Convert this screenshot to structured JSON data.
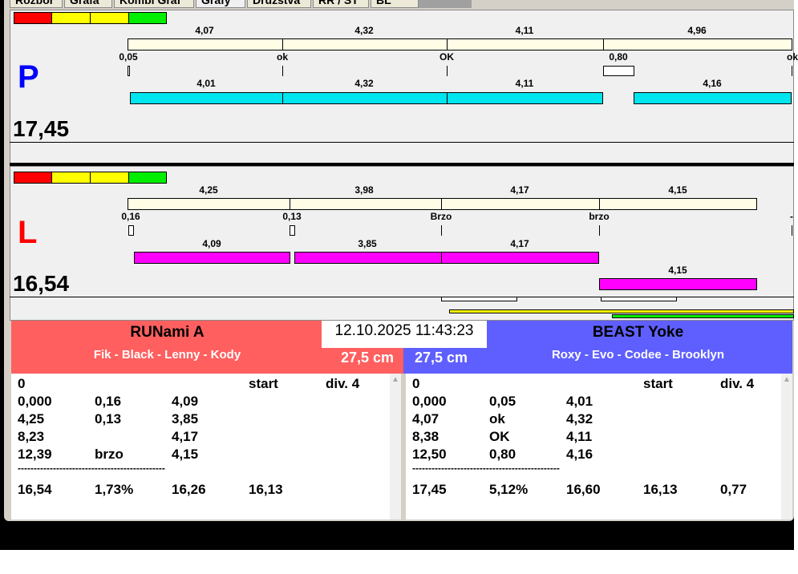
{
  "tabs": [
    "Rozbor",
    "Grafa",
    "Kombi Graf",
    "Grafy",
    "Družstva",
    "RR / ST",
    "BL"
  ],
  "colors": {
    "red_team": "#ff5f5f",
    "blue_team": "#5f5fff",
    "cyan": "#00e5ee",
    "magenta": "#ff00ff",
    "cream": "#fffde6"
  },
  "lane_p": {
    "letter": "P",
    "total": "17,45",
    "split_labels": [
      "4,07",
      "4,32",
      "4,11",
      "4,96"
    ],
    "reaction_labels": [
      "0,05",
      "ok",
      "OK",
      "0,80",
      "ok"
    ],
    "run_labels": [
      "4,01",
      "4,32",
      "4,11",
      "4,16"
    ]
  },
  "lane_l": {
    "letter": "L",
    "total": "16,54",
    "split_labels": [
      "4,25",
      "3,98",
      "4,17",
      "4,15"
    ],
    "reaction_labels": [
      "0,16",
      "0,13",
      "Brzo",
      "brzo",
      "-"
    ],
    "run_labels": [
      "4,09",
      "3,85",
      "4,17",
      "4,15"
    ]
  },
  "datetime": "12.10.2025 11:43:23",
  "left_team": {
    "name": "RUNami A",
    "members": "Fik - Black - Lenny - Kody",
    "height": "27,5 cm",
    "header": [
      "0",
      "",
      "",
      "start",
      "div.  4"
    ],
    "rows": [
      [
        "0,000",
        "0,16",
        "4,09"
      ],
      [
        "4,25",
        "0,13",
        "3,85"
      ],
      [
        "8,23",
        "",
        "4,17"
      ],
      [
        "12,39",
        "brzo",
        "4,15"
      ]
    ],
    "separator": "----------------------------------------------",
    "summary": [
      "16,54",
      "1,73%",
      "16,26",
      "16,13",
      ""
    ]
  },
  "right_team": {
    "name": "BEAST Yoke",
    "members": "Roxy - Evo - Codee - Brooklyn",
    "height": "27,5 cm",
    "header": [
      "0",
      "",
      "",
      "start",
      "div.  4"
    ],
    "rows": [
      [
        "0,000",
        "0,05",
        "4,01"
      ],
      [
        "4,07",
        "ok",
        "4,32"
      ],
      [
        "8,38",
        "OK",
        "4,11"
      ],
      [
        "12,50",
        "0,80",
        "4,16"
      ]
    ],
    "separator": "----------------------------------------------",
    "summary": [
      "17,45",
      "5,12%",
      "16,60",
      "16,13",
      "0,77"
    ]
  }
}
